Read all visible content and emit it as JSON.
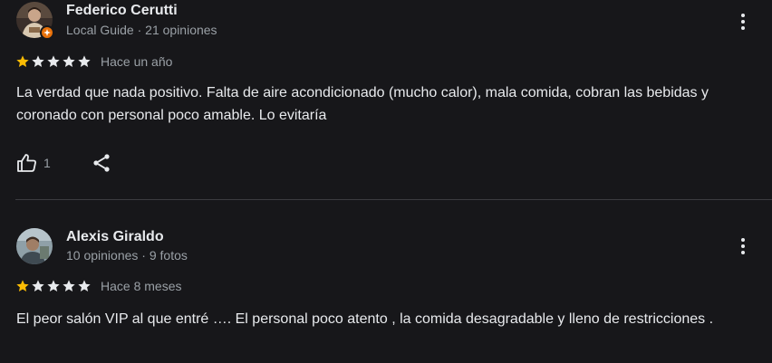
{
  "reviews": [
    {
      "author": "Federico Cerutti",
      "meta": "Local Guide · 21 opiniones",
      "is_local_guide": true,
      "rating": 1,
      "max_rating": 5,
      "date": "Hace un año",
      "text": "La verdad que nada positivo. Falta de aire acondicionado (mucho calor), mala comida, cobran las bebidas y coronado con personal poco amable. Lo evitaría",
      "likes": "1",
      "icons": {
        "like": "thumb-up-icon",
        "share": "share-icon",
        "more": "more-vert-icon"
      }
    },
    {
      "author": "Alexis Giraldo",
      "meta": "10 opiniones · 9 fotos",
      "is_local_guide": false,
      "rating": 1,
      "max_rating": 5,
      "date": "Hace 8 meses",
      "text": "El peor salón VIP al que entré …. El personal poco atento , la comida desagradable y lleno de restricciones .",
      "icons": {
        "more": "more-vert-icon"
      }
    }
  ],
  "colors": {
    "background": "#17171a",
    "star_filled": "#fbbc04",
    "star_empty": "#e8eaed",
    "secondary_text": "#9aa0a6",
    "guide_badge": "#e8710a"
  }
}
